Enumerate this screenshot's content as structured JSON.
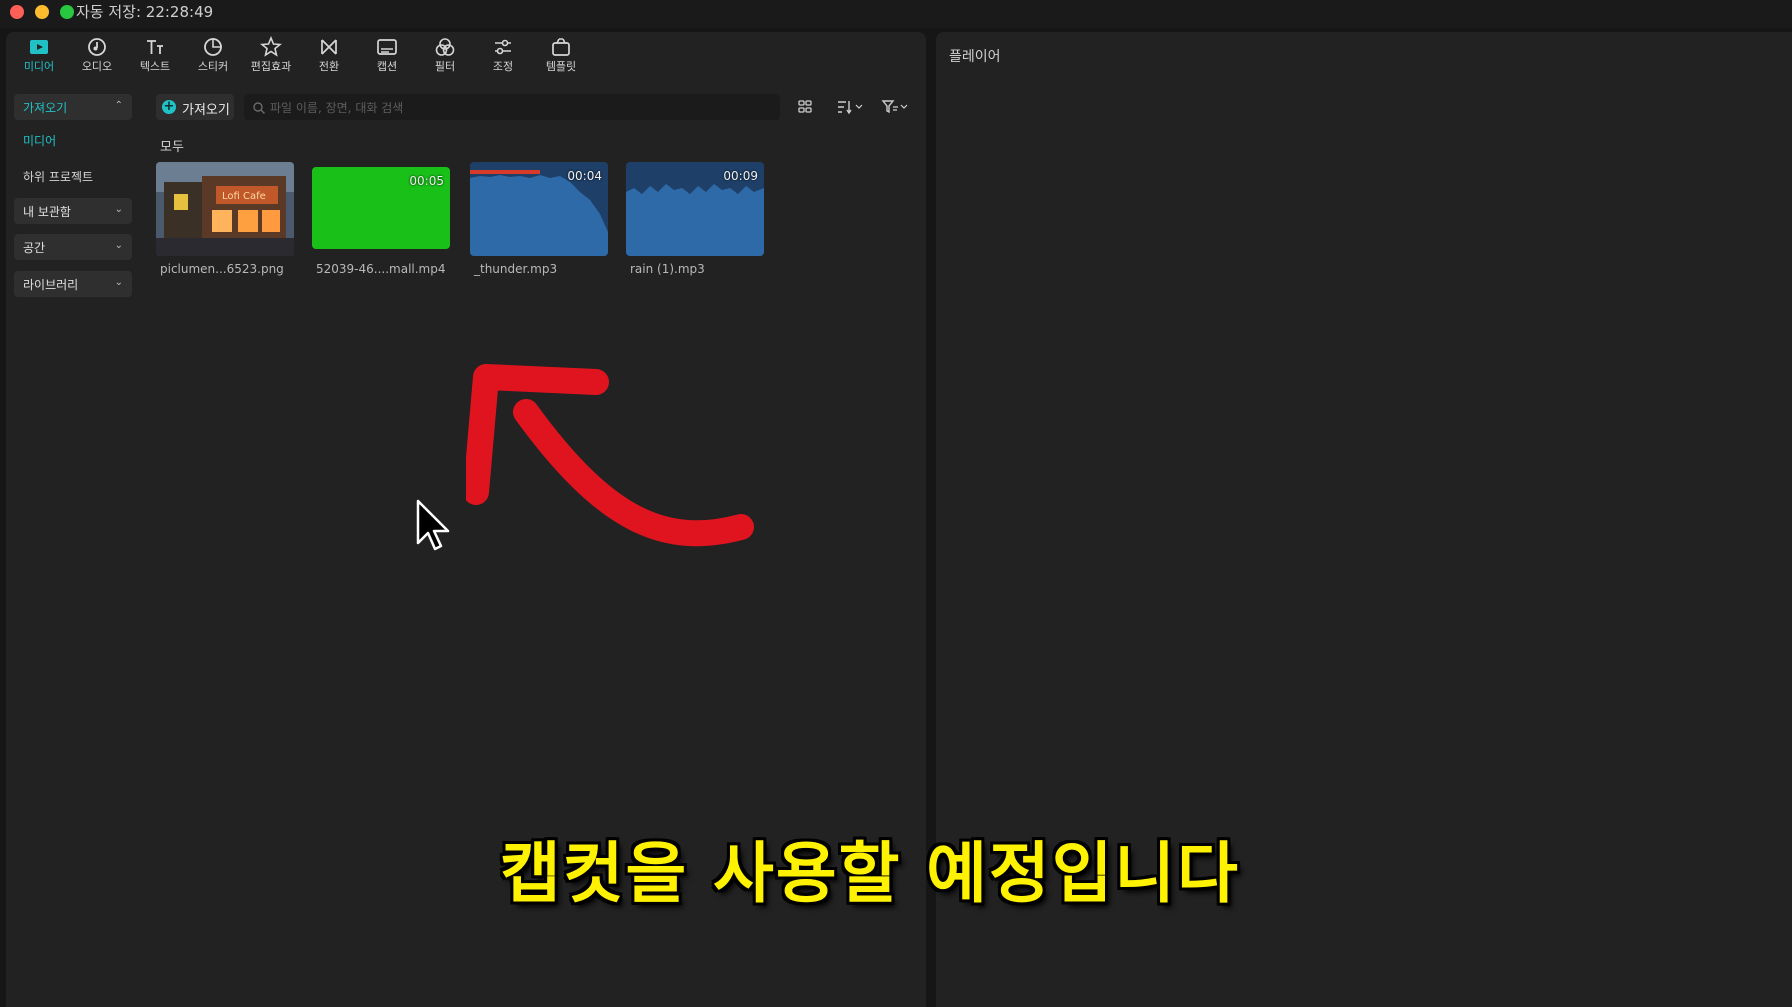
{
  "window": {
    "autosave": "자동 저장: 22:28:49"
  },
  "toolbar": {
    "items": [
      {
        "label": "미디어",
        "icon": "media-icon"
      },
      {
        "label": "오디오",
        "icon": "audio-icon"
      },
      {
        "label": "텍스트",
        "icon": "text-icon"
      },
      {
        "label": "스티커",
        "icon": "sticker-icon"
      },
      {
        "label": "편집효과",
        "icon": "effects-icon"
      },
      {
        "label": "전환",
        "icon": "transition-icon"
      },
      {
        "label": "캡션",
        "icon": "caption-icon"
      },
      {
        "label": "필터",
        "icon": "filter-icon"
      },
      {
        "label": "조정",
        "icon": "adjust-icon"
      },
      {
        "label": "템플릿",
        "icon": "template-icon"
      }
    ],
    "active_color": "#20c2c6"
  },
  "sidebar": {
    "import": "가져오기",
    "media": "미디어",
    "sub_project": "하위 프로젝트",
    "my_storage": "내 보관함",
    "space": "공간",
    "library": "라이브러리"
  },
  "import_button": {
    "label": "가져오기"
  },
  "search": {
    "placeholder": "파일 이름, 장면, 대화 검색"
  },
  "section": {
    "all": "모두"
  },
  "media_items": [
    {
      "name": "piclumen...6523.png",
      "duration": "",
      "kind": "image"
    },
    {
      "name": "52039-46....mall.mp4",
      "duration": "00:05",
      "kind": "video"
    },
    {
      "name": "_thunder.mp3",
      "duration": "00:04",
      "kind": "audio"
    },
    {
      "name": "rain (1).mp3",
      "duration": "00:09",
      "kind": "audio"
    }
  ],
  "player": {
    "title": "플레이어"
  },
  "subtitle": "캡컷을 사용할 예정입니다",
  "annotation": {
    "arrow_color": "#e0141e"
  }
}
